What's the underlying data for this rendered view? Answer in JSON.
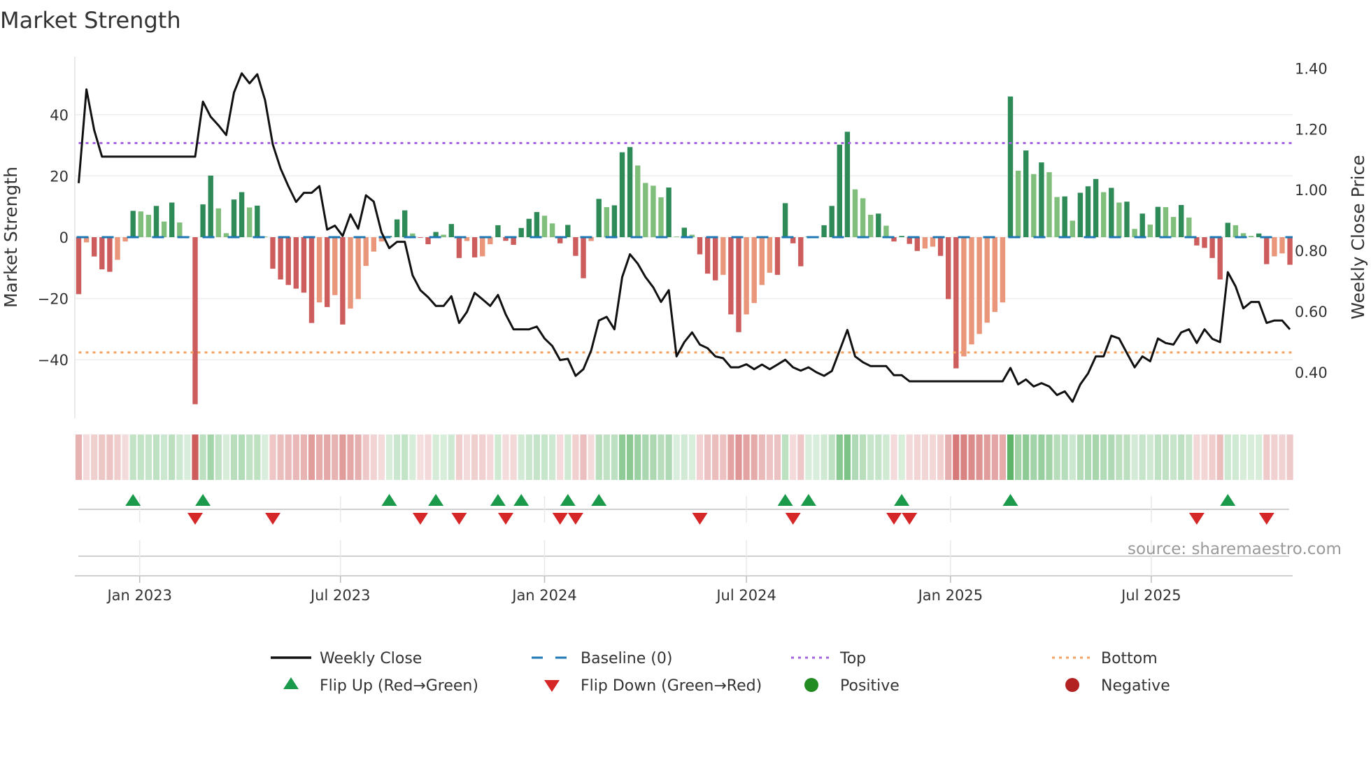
{
  "title": "Market Strength",
  "source": "source: sharemaestro.com",
  "chart_data": {
    "type": "bar",
    "title": "Market Strength",
    "ylabel": "Market Strength",
    "y2label": "Weekly Close Price",
    "ylim": [
      -59,
      59
    ],
    "y2lim": [
      0.25,
      1.437
    ],
    "yticks": [
      {
        "v": 40,
        "label": "40"
      },
      {
        "v": 20,
        "label": "20"
      },
      {
        "v": 0,
        "label": "0"
      },
      {
        "v": -20,
        "label": "−20"
      },
      {
        "v": -40,
        "label": "−40"
      }
    ],
    "y2ticks": [
      {
        "v": 0.4,
        "label": "0.40"
      },
      {
        "v": 0.6,
        "label": "0.60"
      },
      {
        "v": 0.8,
        "label": "0.80"
      },
      {
        "v": 1.0,
        "label": "1.00"
      },
      {
        "v": 1.2,
        "label": "1.20"
      },
      {
        "v": 1.4,
        "label": "1.40"
      }
    ],
    "x_start": "2022-11-07",
    "x_step_days": 7,
    "x_ticks": [
      {
        "label": "Jan 2023",
        "date": "2023-01-01"
      },
      {
        "label": "Jul 2023",
        "date": "2023-07-01"
      },
      {
        "label": "Jan 2024",
        "date": "2024-01-01"
      },
      {
        "label": "Jul 2024",
        "date": "2024-07-01"
      },
      {
        "label": "Jan 2025",
        "date": "2025-01-01"
      },
      {
        "label": "Jul 2025",
        "date": "2025-07-01"
      }
    ],
    "top_level": 30.7,
    "bottom_level": -37.6,
    "baseline": 0,
    "strength": [
      -18.6,
      -1.7,
      -6.3,
      -10.5,
      -11.3,
      -7.4,
      -1.4,
      8.6,
      8.4,
      7.3,
      10.2,
      5.1,
      11.3,
      4.8,
      0.2,
      -54.5,
      10.7,
      20.1,
      9.4,
      1.3,
      12.3,
      14.7,
      9.7,
      10.3,
      0.2,
      -10.3,
      -13.8,
      -15.6,
      -16.8,
      -18.1,
      -28,
      -21.3,
      -22.8,
      -18.9,
      -28.5,
      -23.3,
      -20.2,
      -9.4,
      -4.7,
      -1.4,
      0.4,
      5.8,
      8.75,
      1.2,
      -0.2,
      -2.3,
      1.7,
      0.8,
      4.3,
      -6.8,
      -1.25,
      -6.6,
      -6.25,
      -2.3,
      3.9,
      -1.2,
      -2.5,
      3,
      6,
      8.2,
      7,
      4.5,
      -2,
      4,
      -6.1,
      -13.4,
      -1.25,
      12.5,
      9.8,
      10.4,
      27.7,
      29.4,
      23.4,
      17.7,
      16.8,
      13,
      16.2,
      0.2,
      3.1,
      0.8,
      -5.6,
      -11.9,
      -14.1,
      -12.3,
      -25.2,
      -31,
      -25.2,
      -21.5,
      -15.6,
      -11.6,
      -12.3,
      11.1,
      -2,
      -9.5,
      0.2,
      0.2,
      3.9,
      10.2,
      30.2,
      34.4,
      15.6,
      12.7,
      7.3,
      7.7,
      3.75,
      -1.4,
      0.4,
      -2.2,
      -4.5,
      -3.7,
      -3.1,
      -6.1,
      -20.2,
      -42.8,
      -38.9,
      -35,
      -31.6,
      -27.9,
      -24.4,
      -21.3,
      45.9,
      21.7,
      28.3,
      20.6,
      24.4,
      21.2,
      13.1,
      13.3,
      5.4,
      14.5,
      16.6,
      19,
      14.7,
      16.1,
      11.3,
      11.6,
      2.7,
      7.7,
      4.1,
      9.9,
      9.8,
      6.6,
      10.5,
      6.4,
      -2.7,
      -3.5,
      -6.8,
      -13.8,
      4.7,
      3.9,
      1.3,
      0.4,
      1.2,
      -8.8,
      -6.25,
      -5.3,
      -9
    ],
    "weekly_close": [
      1.022,
      1.33,
      1.196,
      1.109,
      1.109,
      1.109,
      1.109,
      1.109,
      1.109,
      1.109,
      1.109,
      1.109,
      1.109,
      1.109,
      1.109,
      1.109,
      1.29,
      1.24,
      1.212,
      1.18,
      1.32,
      1.383,
      1.35,
      1.38,
      1.295,
      1.149,
      1.07,
      1.012,
      0.96,
      0.99,
      0.99,
      1.012,
      0.869,
      0.882,
      0.848,
      0.919,
      0.872,
      0.982,
      0.961,
      0.86,
      0.808,
      0.829,
      0.829,
      0.719,
      0.67,
      0.647,
      0.618,
      0.618,
      0.65,
      0.562,
      0.598,
      0.661,
      0.64,
      0.618,
      0.654,
      0.59,
      0.541,
      0.541,
      0.541,
      0.55,
      0.511,
      0.486,
      0.44,
      0.444,
      0.388,
      0.41,
      0.471,
      0.57,
      0.582,
      0.541,
      0.713,
      0.788,
      0.757,
      0.713,
      0.679,
      0.631,
      0.67,
      0.452,
      0.499,
      0.531,
      0.491,
      0.479,
      0.452,
      0.446,
      0.416,
      0.416,
      0.426,
      0.41,
      0.425,
      0.41,
      0.425,
      0.441,
      0.416,
      0.405,
      0.416,
      0.4,
      0.388,
      0.404,
      0.471,
      0.539,
      0.452,
      0.433,
      0.42,
      0.42,
      0.42,
      0.39,
      0.39,
      0.37,
      0.37,
      0.37,
      0.37,
      0.37,
      0.37,
      0.37,
      0.37,
      0.37,
      0.37,
      0.37,
      0.37,
      0.37,
      0.414,
      0.36,
      0.376,
      0.353,
      0.364,
      0.353,
      0.325,
      0.337,
      0.303,
      0.36,
      0.396,
      0.452,
      0.452,
      0.52,
      0.511,
      0.463,
      0.416,
      0.452,
      0.436,
      0.511,
      0.496,
      0.491,
      0.531,
      0.541,
      0.496,
      0.541,
      0.51,
      0.499,
      0.729,
      0.682,
      0.61,
      0.631,
      0.631,
      0.562,
      0.57,
      0.57,
      0.541
    ],
    "flip_up_weeks": [
      7,
      16,
      40,
      46,
      54,
      57,
      63,
      67,
      91,
      94,
      106,
      120,
      148
    ],
    "flip_down_weeks": [
      15,
      25,
      44,
      49,
      55,
      62,
      64,
      80,
      92,
      105,
      107,
      144,
      153
    ],
    "legend_position": "bottom",
    "legend": [
      {
        "key": "close",
        "label": "Weekly Close"
      },
      {
        "key": "baseline",
        "label": "Baseline (0)"
      },
      {
        "key": "top",
        "label": "Top"
      },
      {
        "key": "bottom",
        "label": "Bottom"
      },
      {
        "key": "flip_up",
        "label": "Flip Up (Red→Green)"
      },
      {
        "key": "flip_down",
        "label": "Flip Down (Green→Red)"
      },
      {
        "key": "positive",
        "label": "Positive"
      },
      {
        "key": "negative",
        "label": "Negative"
      }
    ]
  },
  "colors": {
    "pos_strong": "#2e8b57",
    "pos_weak": "#7fbf7b",
    "neg_strong": "#cd5c5c",
    "neg_weak": "#e9967a",
    "close": "#111111",
    "baseline": "#1f77b4",
    "top": "#a463e0",
    "bottom": "#f4a261",
    "flip_up": "#1a9a4a",
    "flip_down": "#d62728",
    "positive": "#228b22",
    "negative": "#b22222"
  }
}
